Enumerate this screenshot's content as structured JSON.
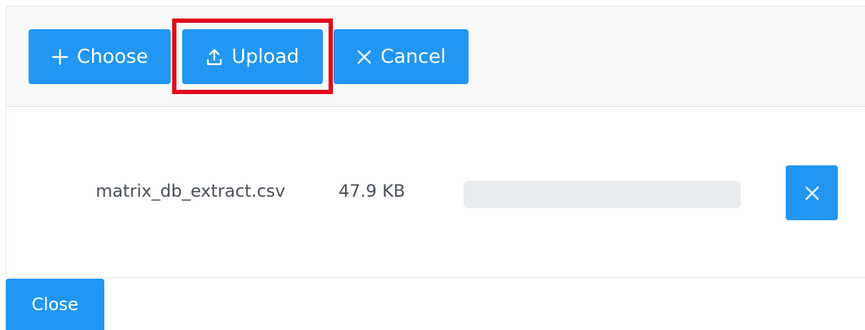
{
  "toolbar": {
    "choose_label": "Choose",
    "choose_icon": "plus-icon",
    "upload_label": "Upload",
    "upload_icon": "upload-icon",
    "cancel_label": "Cancel",
    "cancel_icon": "close-icon",
    "highlighted_button": "upload"
  },
  "files": [
    {
      "name": "matrix_db_extract.csv",
      "size": "47.9 KB",
      "progress": 0,
      "remove_icon": "close-icon"
    }
  ],
  "footer": {
    "close_label": "Close"
  },
  "colors": {
    "accent": "#2196f3",
    "highlight": "#e10b1b",
    "progress_track": "#e9ecef",
    "text": "#495057"
  }
}
